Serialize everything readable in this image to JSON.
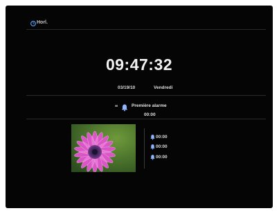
{
  "header": {
    "label": "Horl.",
    "icon": "clock-icon"
  },
  "clock": {
    "time": "09:47:32",
    "date": "03/19/10",
    "weekday": "Vendredi"
  },
  "primary_alarm": {
    "quote_open": "\"",
    "icon": "bell-icon",
    "title": "Première alarme",
    "time": "00:00"
  },
  "photo": {
    "subject": "pink-flower-icon"
  },
  "alarms": [
    {
      "icon": "bell-icon",
      "time": "00:00"
    },
    {
      "icon": "bell-icon",
      "time": "00:00"
    },
    {
      "icon": "bell-icon",
      "time": "00:00"
    }
  ],
  "colors": {
    "background": "#050505",
    "text": "#e6e6e6",
    "accent_blue": "#5aa6ff"
  }
}
